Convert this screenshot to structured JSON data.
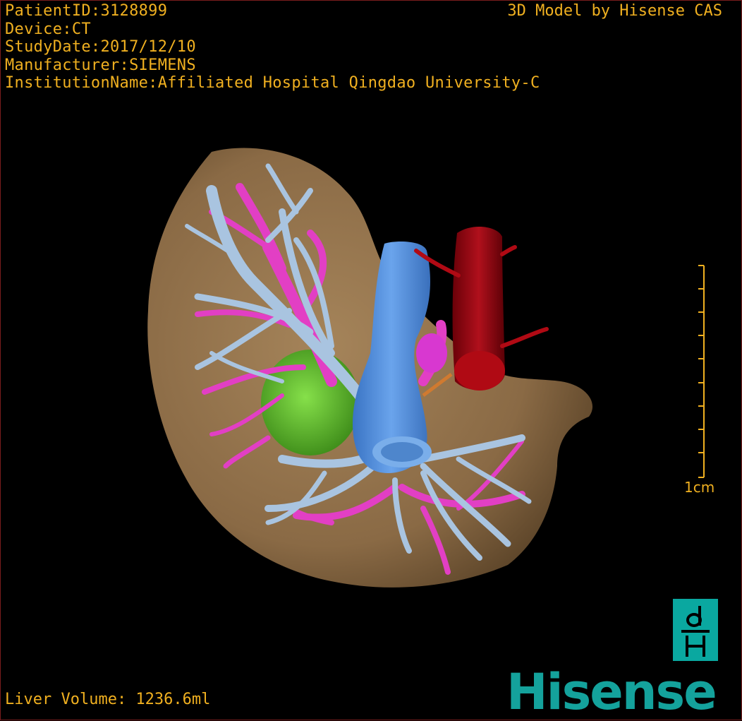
{
  "overlay": {
    "patient_id": "PatientID:3128899",
    "device": "Device:CT",
    "study_date": "StudyDate:2017/12/10",
    "manufacturer": "Manufacturer:SIEMENS",
    "institution": "InstitutionName:Affiliated Hospital Qingdao University-C",
    "credit": "3D Model by Hisense CAS",
    "liver_volume": "Liver Volume: 1236.6ml"
  },
  "scale_bar": {
    "label": "1cm"
  },
  "brand": {
    "name": "Hisense",
    "logo_glyphs": "dH"
  },
  "colors": {
    "text": "#f0b020",
    "liver": "#8a6a45",
    "hepatic_vein": "#a9c4e0",
    "portal_vein": "#e040c0",
    "vena_cava": "#4a88d8",
    "aorta": "#a00010",
    "tumor": "#5cb82a",
    "brand": "#14a29c"
  }
}
